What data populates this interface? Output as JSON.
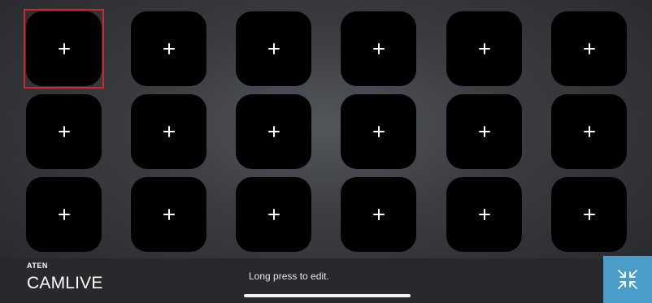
{
  "grid": {
    "rows": 3,
    "columns": 6,
    "key_symbol": "+",
    "selected_index": 0
  },
  "brand": {
    "maker": "ATEN",
    "product": "CAMLIVE"
  },
  "footer": {
    "hint": "Long press to edit."
  },
  "icons": {
    "add": "plus-icon",
    "collapse": "collapse-arrows-icon"
  },
  "colors": {
    "selection": "#d0262d",
    "accent": "#4a9cc9",
    "key_background": "#000000"
  }
}
